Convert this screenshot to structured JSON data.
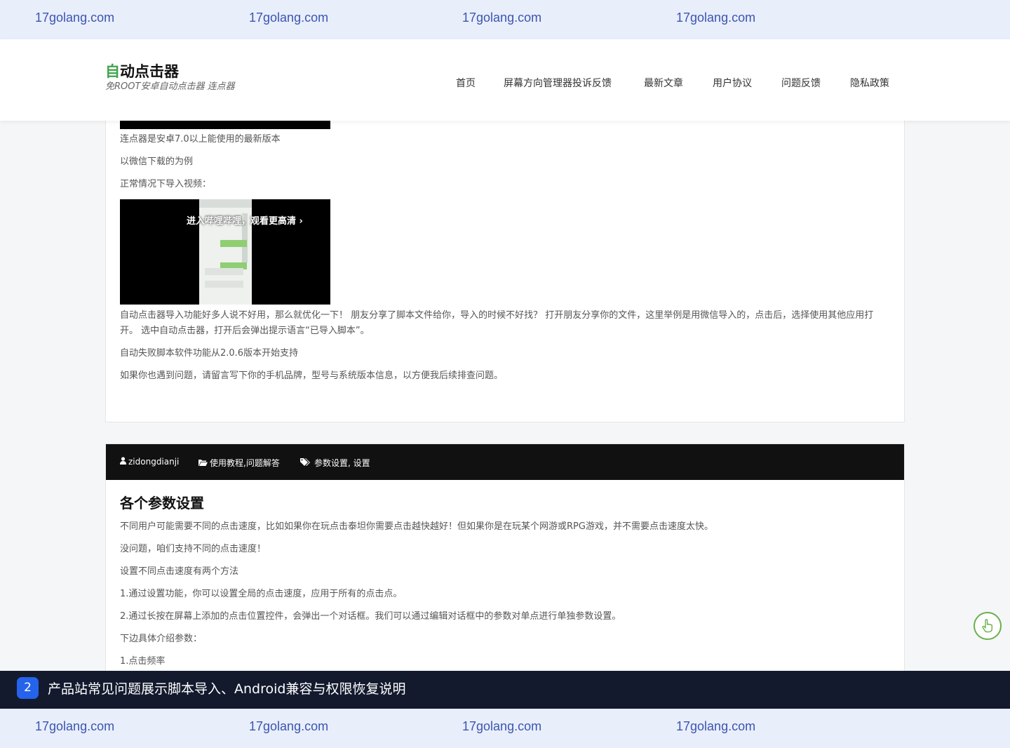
{
  "watermark": {
    "text": "17golang.com"
  },
  "site": {
    "name_accent": "自",
    "name_rest": "动点击器",
    "tagline": "免ROOT安卓自动点击器 连点器"
  },
  "nav": [
    "首页",
    "屏幕方向管理器投诉反馈",
    "最新文章",
    "用户协议",
    "问题反馈",
    "隐私政策"
  ],
  "post1": {
    "lines": [
      "连点器是安卓7.0以上能使用的最新版本",
      "以微信下载的为例",
      "正常情况下导入视频："
    ],
    "video_caption": "进入哔哩哔哩，观看更高清 ›",
    "paragraph": "自动点击器导入功能好多人说不好用，那么就优化一下！ 朋友分享了脚本文件给你，导入的时候不好找？ 打开朋友分享你的文件，这里举例是用微信导入的，点击后，选择使用其他应用打开。 选中自动点击器，打开后会弹出提示语言“已导入脚本”。",
    "line_after_1": "自动失败脚本软件功能从2.0.6版本开始支持",
    "line_after_2": "如果你也遇到问题，请留言写下你的手机品牌，型号与系统版本信息，以方便我后续排查问题。"
  },
  "post2": {
    "author": "zidongdianji",
    "categories": "使用教程,问题解答",
    "tags": "参数设置, 设置",
    "title": "各个参数设置",
    "lines": [
      "不同用户可能需要不同的点击速度，比如如果你在玩点击泰坦你需要点击越快越好！但如果你是在玩某个网游或RPG游戏，并不需要点击速度太快。",
      "没问题，咱们支持不同的点击速度！",
      "设置不同点击速度有两个方法",
      "1.通过设置功能，你可以设置全局的点击速度，应用于所有的点击点。",
      "2.通过长按在屏幕上添加的点击位置控件，会弹出一个对话框。我们可以通过编辑对话框中的参数对单点进行单独参数设置。",
      "下边具体介绍参数：",
      "1.点击频率"
    ]
  },
  "banner": {
    "badge": "2",
    "text": "产品站常见问题展示脚本导入、Android兼容与权限恢复说明"
  },
  "icons": {
    "user": "user-icon",
    "folder": "folder-open-icon",
    "tags": "tags-icon",
    "floating": "hand-pointer-icon"
  },
  "colors": {
    "accent_green": "#3fa34d",
    "watermark_blue": "#3a56b0",
    "banner_bg": "#141a2e",
    "badge_blue": "#2563eb"
  }
}
